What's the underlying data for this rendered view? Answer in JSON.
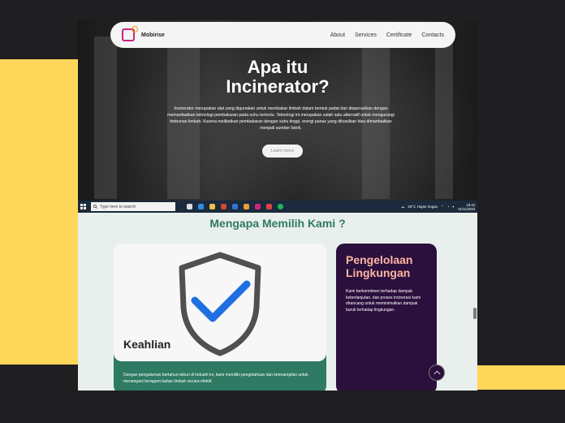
{
  "nav": {
    "brand": "Mobirise",
    "links": [
      "About",
      "Services",
      "Certificate",
      "Contacts"
    ]
  },
  "hero": {
    "title_line1": "Apa itu",
    "title_line2": "Incinerator?",
    "text": "Incinerator merupakan alat yang digunakan untuk membakar limbah dalam bentuk padat dan dioperasikan dengan memanfaatkan teknologi pembakaran pada suhu tertentu. Teknologi ini merupakan salah satu alternatif untuk mengurangi timbunan limbah. Karena melibatkan pembakaran dengan suhu tinggi, energi panas yang dihasilkan bisa dimanfaatkan menjadi sumber listrik.",
    "button": "Learn more"
  },
  "taskbar": {
    "search_placeholder": "Type here to search",
    "weather": "26°C  Hujan ringan",
    "time": "19:44",
    "date": "01/11/2023"
  },
  "section": {
    "title": "Mengapa Memilih Kami ?"
  },
  "card_expertise": {
    "title": "Keahlian",
    "text": "Dengan pengalaman bertahun-tahun di industri ini, kami memiliki pengetahuan dan keterampilan untuk menangani beragam bahan limbah secara efektif."
  },
  "card_environment": {
    "title_line1": "Pengelolaan",
    "title_line2": "Lingkungan",
    "text": "Kami berkomitmen terhadap dampak keberlanjutan, dan proses incinerasi kami dirancang untuk meminimalkan dampak buruk terhadap lingkungan."
  },
  "colors": {
    "accent_green": "#2e7a63",
    "accent_purple": "#2b0f3c",
    "accent_yellow": "#ffd75a",
    "accent_peach": "#ffb7a4"
  }
}
